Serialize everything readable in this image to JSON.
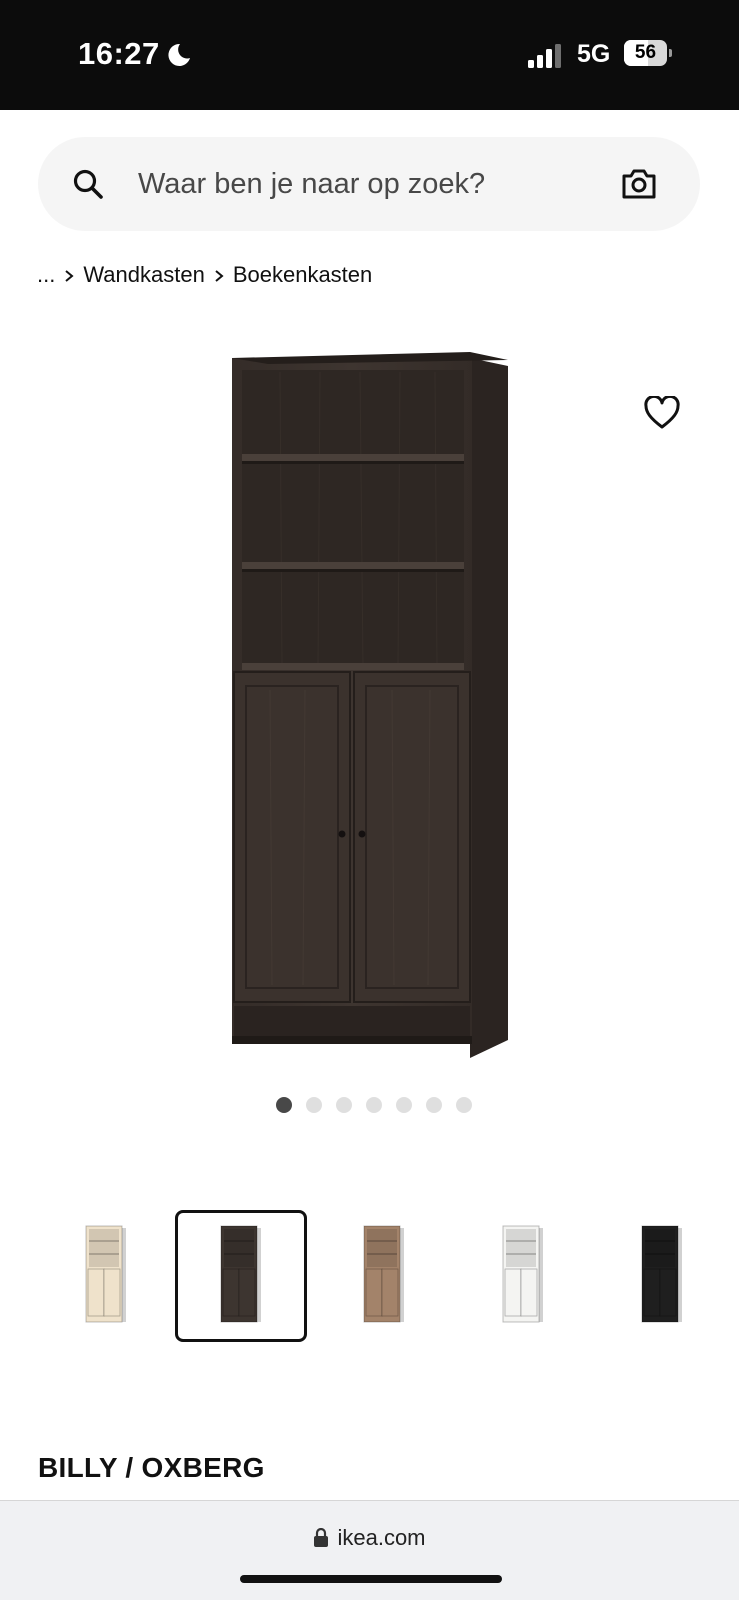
{
  "status_bar": {
    "time": "16:27",
    "network": "5G",
    "battery": "56",
    "battery_level": 0.56
  },
  "search": {
    "placeholder": "Waar ben je naar op zoek?",
    "value": "",
    "icons": [
      "search-icon",
      "camera-icon"
    ]
  },
  "breadcrumb": {
    "ellipsis": "...",
    "items": [
      "Wandkasten",
      "Boekenkasten"
    ]
  },
  "gallery": {
    "total_images": 7,
    "active_index": 0,
    "favorite_icon": "heart-outline-icon"
  },
  "variants": {
    "selected_index": 1,
    "colors": [
      "#efe2cb",
      "#3d3530",
      "#a3836a",
      "#f4f4f2",
      "#1f1f1f"
    ]
  },
  "product": {
    "title": "BILLY / OXBERG"
  },
  "browser": {
    "url": "ikea.com"
  },
  "colors": {
    "wood_dark": "#3a322d",
    "active_dot": "#484848",
    "inactive_dot": "#dfdfdf"
  }
}
